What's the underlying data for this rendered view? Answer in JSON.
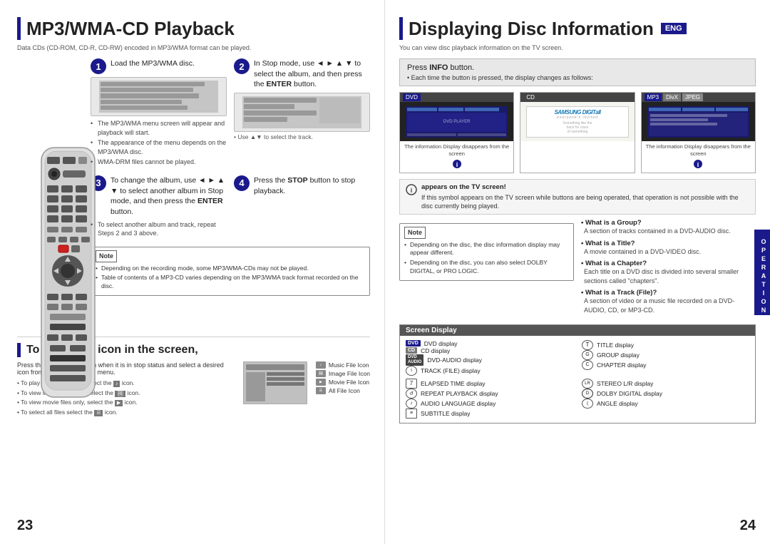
{
  "left": {
    "title": "MP3/WMA-CD Playback",
    "title_bar": true,
    "subtitle": "Data CDs (CD-ROM, CD-R, CD-RW) encoded in MP3/WMA format can be played.",
    "steps": [
      {
        "num": "1",
        "text": "Load the MP3/WMA disc."
      },
      {
        "num": "2",
        "text": "In Stop mode, use ◄ ► ▲ ▼ to select the album, and then press the ENTER button."
      },
      {
        "num": "3",
        "text": "To change the album, use ◄ ► ▲ ▼ to select another album in Stop mode, and then press the ENTER button."
      },
      {
        "num": "4",
        "text": "Press the STOP button to stop playback."
      }
    ],
    "bullets_step1": [
      "The MP3/WMA menu screen will appear and playback will start.",
      "The appearance of the menu depends on the MP3/WMA disc.",
      "WMA-DRM files cannot be played."
    ],
    "use_note_step2": "• Use ▲▼ to select the track.",
    "bullets_step3": [
      "To select another album and track, repeat Steps 2 and 3 above."
    ],
    "note_label": "Note",
    "note_items": [
      "Depending on the recording mode, some MP3/WMA-CDs may not be played.",
      "Table of contents of a MP3-CD varies depending on the MP3/WMA track format recorded on the disc."
    ],
    "file_section_title": "To play a file icon in the screen,",
    "file_section_body": "Press the ◄ ► ▲ ▼ button when it is in stop status and select a desired icon from the top part of the menu.",
    "file_bullets": [
      "To play music files only, select the [icon] icon.",
      "To view image files only, select the [icon] icon.",
      "To view movie files only, select the [icon] icon.",
      "To select all files select the [icon] icon."
    ],
    "file_icons": [
      "Music File Icon",
      "Image File Icon",
      "Movie File Icon",
      "All File Icon"
    ],
    "page_number": "23"
  },
  "right": {
    "title": "Displaying Disc Information",
    "eng_badge": "ENG",
    "subtitle": "You can view disc playback information  on the TV screen.",
    "info_button": "Press INFO button.",
    "info_button_sub": "• Each time the button is pressed, the display changes as follows:",
    "tv_screens": [
      {
        "label": "DVD",
        "caption": "The information Display disappears from the screen"
      },
      {
        "label": "CD",
        "caption": ""
      },
      {
        "label3a": "MP3",
        "label3b": "DivX",
        "label3c": "JPEG",
        "caption": "The information Display disappears from the screen"
      }
    ],
    "symbol_title": "appears on the TV screen!",
    "symbol_body": "If this symbol appears on the TV screen while buttons are being operated, that operation is not possible with the disc currently being played.",
    "faq": [
      {
        "q": "What is a Group?",
        "a": "A section of tracks contained in a DVD-AUDIO disc."
      },
      {
        "q": "What is a Title?",
        "a": "A movie contained in a DVD-VIDEO disc."
      },
      {
        "q": "What is a Chapter?",
        "a": "Each title on a DVD disc is divided into several smaller sections called \"chapters\"."
      },
      {
        "q": "What is a Track (File)?",
        "a": "A section of video or a music file recorded on a DVD-AUDIO, CD, or MP3-CD."
      }
    ],
    "screen_display_label": "Screen Display",
    "display_items_col1": [
      {
        "badge": "DVD",
        "text": "DVD display"
      },
      {
        "badge": "CD",
        "text": "CD display"
      },
      {
        "badge": "DVD AUDIO",
        "text": "DVD-AUDIO display"
      },
      {
        "icon": "circle-i",
        "text": "TRACK (FILE) display"
      }
    ],
    "display_items_col2": [
      {
        "icon": "T",
        "text": "TITLE display"
      },
      {
        "icon": "G",
        "text": "GROUP display"
      },
      {
        "icon": "C",
        "text": "CHAPTER display"
      }
    ],
    "display_items_col3": [
      {
        "icon": "7",
        "text": "ELAPSED TIME display"
      },
      {
        "icon": "rep",
        "text": "REPEAT PLAYBACK display"
      },
      {
        "icon": "audio",
        "text": "AUDIO LANGUAGE display"
      },
      {
        "icon": "sub",
        "text": "SUBTITLE display"
      }
    ],
    "display_items_col4": [
      {
        "icon": "LR",
        "text": "STEREO L/R display"
      },
      {
        "icon": "dolby",
        "text": "DOLBY DIGITAL display"
      },
      {
        "icon": "angle",
        "text": "ANGLE display"
      }
    ],
    "operation_label": "OPERATION",
    "page_number": "24"
  }
}
